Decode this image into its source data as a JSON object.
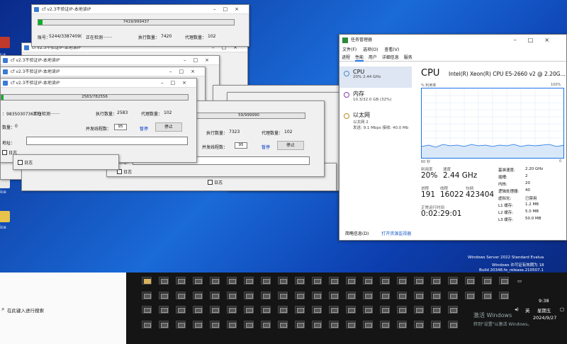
{
  "desktop": {
    "icon_labels": [
      "r-a...",
      "ice",
      "ice"
    ]
  },
  "tool_windows": {
    "title": "cf v2.3不验证IP-本地读IP",
    "w1": {
      "progress": "7419/999437",
      "account_label": "账号：",
      "account": "5244/3387409(",
      "status": "正在检测·······",
      "exec_label": "执行数量：",
      "exec": "7420",
      "proxy_label": "代理数量：",
      "proxy": "102"
    },
    "w2": {
      "progress": "2583/782556",
      "account": "：9835030736373",
      "status": "正在检测·······",
      "exec_label": "执行数量：",
      "exec": "2583",
      "proxy_label": "代理数量：",
      "proxy": "102",
      "count_label": "数量：",
      "count": "0",
      "threads_label": "并发线程数：",
      "threads": "95",
      "pause": "暂停",
      "stop": "停止",
      "addr_label": "地址：",
      "log_label": "日志"
    },
    "w3": {
      "progress": "59/999990",
      "exec_label": "执行数量：",
      "exec": "7323",
      "proxy_label": "代理数量：",
      "proxy": "102",
      "threads_label": "并发线程数：",
      "threads": "95",
      "pause": "暂停",
      "stop": "停止",
      "addr_label": "接地址：",
      "log_label": "日志"
    },
    "extra_log": "日志"
  },
  "task_manager": {
    "title": "任务管理器",
    "menu": [
      "文件(F)",
      "选项(O)",
      "查看(V)"
    ],
    "tabs": [
      "进程",
      "性能",
      "用户",
      "详细信息",
      "服务"
    ],
    "active_tab": 1,
    "side": [
      {
        "name": "CPU",
        "detail": "20%  2.44 GHz"
      },
      {
        "name": "内存",
        "detail": "10.3/32.0 GB (32%)"
      },
      {
        "name": "以太网",
        "detail": "以太网 2",
        "detail2": "发送: 9.1 Mbps  接收: 40.0 Mb"
      }
    ],
    "cpu_title": "CPU",
    "cpu_name": "Intel(R) Xeon(R) CPU E5-2660 v2 @ 2.20G...",
    "graph_label": "% 利用率",
    "graph_max": "100%",
    "graph_time": "60 秒",
    "graph_min": "0",
    "util_label": "利用率",
    "util": "20%",
    "speed_label": "速度",
    "speed": "2.44 GHz",
    "proc_label": "进程",
    "proc": "191",
    "thread_label": "线程",
    "thread": "16022",
    "handle_label": "句柄",
    "handle": "423404",
    "uptime_label": "正常运行时间",
    "uptime": "0:02:29:01",
    "specs": [
      [
        "基准速度:",
        "2.20 GHz"
      ],
      [
        "插槽:",
        "2"
      ],
      [
        "内核:",
        "20"
      ],
      [
        "逻辑处理器:",
        "40"
      ],
      [
        "虚拟化:",
        "已禁用"
      ],
      [
        "L1 缓存:",
        "1.2 MB"
      ],
      [
        "L2 缓存:",
        "5.0 MB"
      ],
      [
        "L3 缓存:",
        "50.0 MB"
      ]
    ],
    "footer_less": "简略信息(D)",
    "footer_monitor": "打开资源监视器"
  },
  "watermark": {
    "line1": "Windows Server 2022 Standard Evalua",
    "line2": "Windows 许可证有效期为 18",
    "line3": "Build 20348.fe_release.210507.1"
  },
  "activation": {
    "line1": "激活 Windows",
    "line2": "转到\"设置\"以激活 Windows。"
  },
  "taskbar": {
    "search_placeholder": "在此键入进行搜索",
    "time": "9:38",
    "weekday": "星期五",
    "date": "2024/9/27",
    "ime": "英"
  }
}
